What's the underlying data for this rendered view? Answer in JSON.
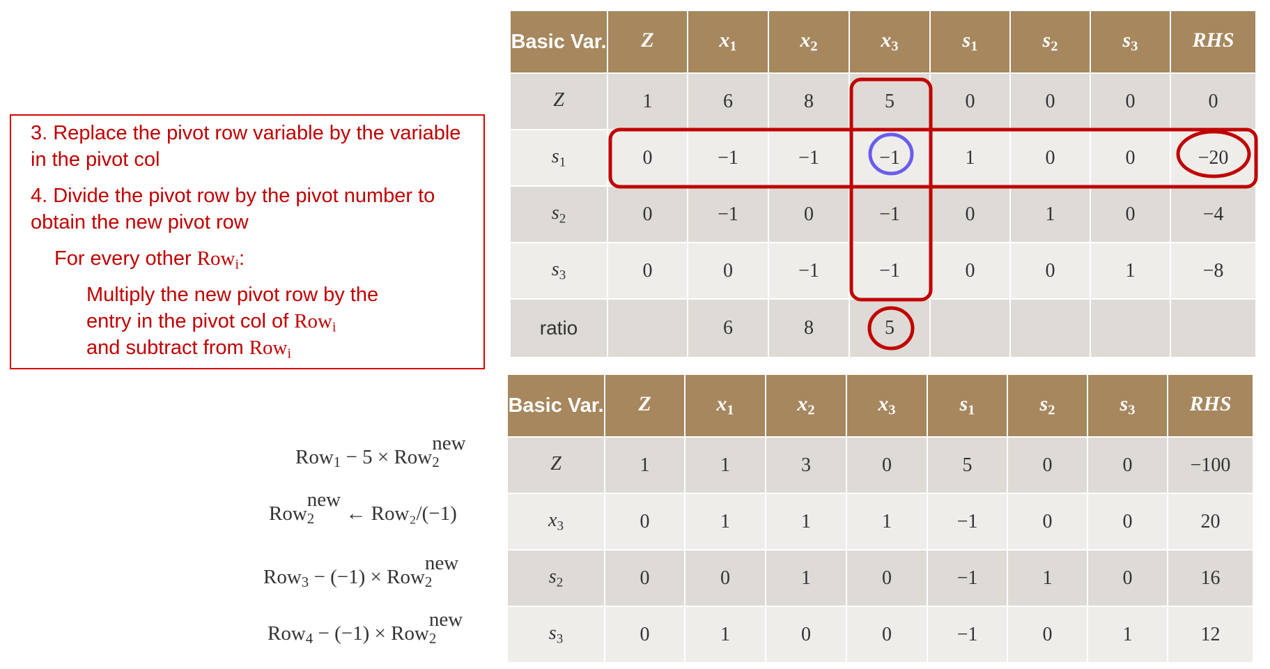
{
  "instructions": {
    "step3": "3. Replace the pivot row variable by the variable in the pivot col",
    "step4": "4. Divide the pivot row by the pivot number to obtain the new pivot row",
    "for_every_prefix": "For every other ",
    "row_i": "Row",
    "i": "i",
    "colon": ":",
    "multiply_line1": "Multiply the new pivot row by the",
    "multiply_line2_prefix": "entry in the pivot col of ",
    "subtract_prefix": "and subtract from "
  },
  "table1": {
    "basic_var_label": "Basic Var.",
    "headers": [
      {
        "base": "Z",
        "sub": ""
      },
      {
        "base": "x",
        "sub": "1"
      },
      {
        "base": "x",
        "sub": "2"
      },
      {
        "base": "x",
        "sub": "3"
      },
      {
        "base": "s",
        "sub": "1"
      },
      {
        "base": "s",
        "sub": "2"
      },
      {
        "base": "s",
        "sub": "3"
      },
      {
        "base": "RHS",
        "sub": ""
      }
    ],
    "rows": [
      {
        "var": "Z",
        "sub": "",
        "cells": [
          "1",
          "6",
          "8",
          "5",
          "0",
          "0",
          "0",
          "0"
        ]
      },
      {
        "var": "s",
        "sub": "1",
        "cells": [
          "0",
          "−1",
          "−1",
          "−1",
          "1",
          "0",
          "0",
          "−20"
        ]
      },
      {
        "var": "s",
        "sub": "2",
        "cells": [
          "0",
          "−1",
          "0",
          "−1",
          "0",
          "1",
          "0",
          "−4"
        ]
      },
      {
        "var": "s",
        "sub": "3",
        "cells": [
          "0",
          "0",
          "−1",
          "−1",
          "0",
          "0",
          "1",
          "−8"
        ]
      },
      {
        "var": "ratio",
        "sub": "",
        "cells": [
          "",
          "6",
          "8",
          "5",
          "",
          "",
          "",
          ""
        ]
      }
    ]
  },
  "table2": {
    "basic_var_label": "Basic Var.",
    "headers": [
      {
        "base": "Z",
        "sub": ""
      },
      {
        "base": "x",
        "sub": "1"
      },
      {
        "base": "x",
        "sub": "2"
      },
      {
        "base": "x",
        "sub": "3"
      },
      {
        "base": "s",
        "sub": "1"
      },
      {
        "base": "s",
        "sub": "2"
      },
      {
        "base": "s",
        "sub": "3"
      },
      {
        "base": "RHS",
        "sub": ""
      }
    ],
    "rows": [
      {
        "var": "Z",
        "sub": "",
        "cells": [
          "1",
          "1",
          "3",
          "0",
          "5",
          "0",
          "0",
          "−100"
        ]
      },
      {
        "var": "x",
        "sub": "3",
        "cells": [
          "0",
          "1",
          "1",
          "1",
          "−1",
          "0",
          "0",
          "20"
        ]
      },
      {
        "var": "s",
        "sub": "2",
        "cells": [
          "0",
          "0",
          "1",
          "0",
          "−1",
          "1",
          "0",
          "16"
        ]
      },
      {
        "var": "s",
        "sub": "3",
        "cells": [
          "0",
          "1",
          "0",
          "0",
          "−1",
          "0",
          "1",
          "12"
        ]
      }
    ]
  },
  "operations": [
    {
      "pre": "Row",
      "pre_sub": "1",
      "mid": " − 5 × ",
      "row2": "Row",
      "sup": "new",
      "sub2": "2",
      "post": ""
    },
    {
      "pre": "Row",
      "pre_sub": "",
      "mid": "",
      "row2": "",
      "sup": "new",
      "sub2": "2",
      "post": " ← Row₂/(−1)"
    },
    {
      "pre": "Row",
      "pre_sub": "3",
      "mid": " − (−1) × ",
      "row2": "Row",
      "sup": "new",
      "sub2": "2",
      "post": ""
    },
    {
      "pre": "Row",
      "pre_sub": "4",
      "mid": " − (−1) × ",
      "row2": "Row",
      "sup": "new",
      "sub2": "2",
      "post": ""
    }
  ],
  "colors": {
    "header_bg": "#a6875e",
    "row_dark": "#dedad5",
    "row_light": "#efede9",
    "highlight_red": "#c00000",
    "pivot_circle_blue": "#6a5cf0"
  }
}
